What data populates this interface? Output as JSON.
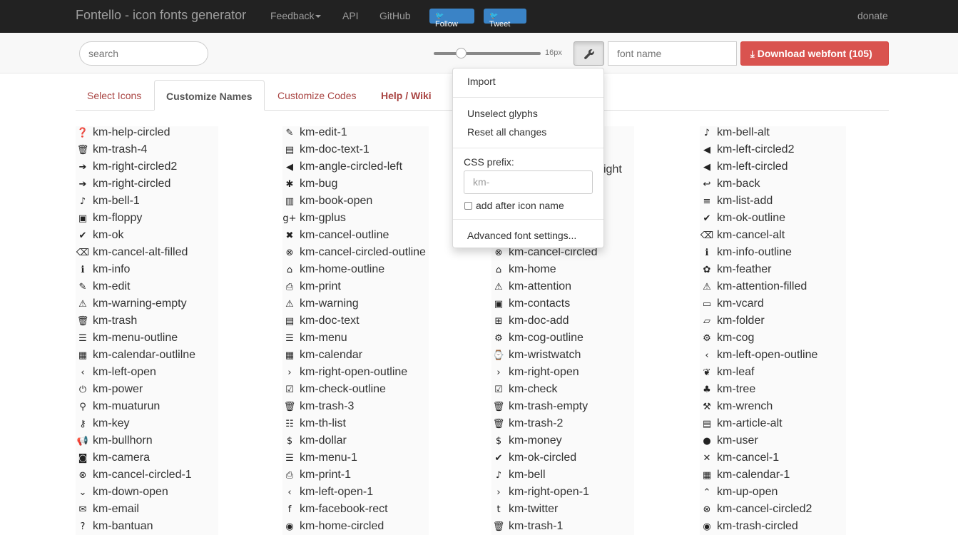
{
  "navbar": {
    "brand": "Fontello - icon fonts generator",
    "feedback": "Feedback",
    "api": "API",
    "github": "GitHub",
    "follow": "Follow",
    "tweet": "Tweet",
    "donate": "donate"
  },
  "toolbar": {
    "search_placeholder": "search",
    "size_label": "16px",
    "font_name_placeholder": "font name",
    "download_label": "Download webfont (105)"
  },
  "tabs": {
    "select": "Select Icons",
    "customize_names": "Customize Names",
    "customize_codes": "Customize Codes",
    "help": "Help / Wiki"
  },
  "dropdown": {
    "import": "Import",
    "unselect": "Unselect glyphs",
    "reset": "Reset all changes",
    "css_prefix_label": "CSS prefix:",
    "css_prefix_value": "km-",
    "add_after_label": "add after icon name",
    "advanced": "Advanced font settings..."
  },
  "columns": [
    [
      {
        "icon": "help-circled-icon",
        "glyph": "❓",
        "name": "km-help-circled"
      },
      {
        "icon": "trash-icon",
        "glyph": "🗑",
        "name": "km-trash-4"
      },
      {
        "icon": "right-circled-icon",
        "glyph": "➔",
        "name": "km-right-circled2"
      },
      {
        "icon": "right-circled-icon",
        "glyph": "➔",
        "name": "km-right-circled"
      },
      {
        "icon": "bell-icon",
        "glyph": "♪",
        "name": "km-bell-1"
      },
      {
        "icon": "floppy-icon",
        "glyph": "▣",
        "name": "km-floppy"
      },
      {
        "icon": "ok-icon",
        "glyph": "✔",
        "name": "km-ok"
      },
      {
        "icon": "cancel-alt-filled-icon",
        "glyph": "⌫",
        "name": "km-cancel-alt-filled"
      },
      {
        "icon": "info-icon",
        "glyph": "ℹ",
        "name": "km-info"
      },
      {
        "icon": "edit-icon",
        "glyph": "✎",
        "name": "km-edit"
      },
      {
        "icon": "warning-empty-icon",
        "glyph": "⚠",
        "name": "km-warning-empty"
      },
      {
        "icon": "trash-icon",
        "glyph": "🗑",
        "name": "km-trash"
      },
      {
        "icon": "menu-outline-icon",
        "glyph": "☰",
        "name": "km-menu-outline"
      },
      {
        "icon": "calendar-icon",
        "glyph": "▦",
        "name": "km-calendar-outlilne"
      },
      {
        "icon": "left-open-icon",
        "glyph": "‹",
        "name": "km-left-open"
      },
      {
        "icon": "power-icon",
        "glyph": "⏻",
        "name": "km-power"
      },
      {
        "icon": "muaturun-icon",
        "glyph": "⚲",
        "name": "km-muaturun"
      },
      {
        "icon": "key-icon",
        "glyph": "⚷",
        "name": "km-key"
      },
      {
        "icon": "bullhorn-icon",
        "glyph": "📢",
        "name": "km-bullhorn"
      },
      {
        "icon": "camera-icon",
        "glyph": "◙",
        "name": "km-camera"
      },
      {
        "icon": "cancel-circled-icon",
        "glyph": "⊗",
        "name": "km-cancel-circled-1"
      },
      {
        "icon": "down-open-icon",
        "glyph": "⌄",
        "name": "km-down-open"
      },
      {
        "icon": "email-icon",
        "glyph": "✉",
        "name": "km-email"
      },
      {
        "icon": "bantuan-icon",
        "glyph": "?",
        "name": "km-bantuan"
      }
    ],
    [
      {
        "icon": "edit-icon",
        "glyph": "✎",
        "name": "km-edit-1"
      },
      {
        "icon": "doc-text-icon",
        "glyph": "▤",
        "name": "km-doc-text-1"
      },
      {
        "icon": "angle-circled-left-icon",
        "glyph": "◀",
        "name": "km-angle-circled-left"
      },
      {
        "icon": "bug-icon",
        "glyph": "✱",
        "name": "km-bug"
      },
      {
        "icon": "book-open-icon",
        "glyph": "▥",
        "name": "km-book-open"
      },
      {
        "icon": "gplus-icon",
        "glyph": "g+",
        "name": "km-gplus"
      },
      {
        "icon": "cancel-outline-icon",
        "glyph": "✖",
        "name": "km-cancel-outline"
      },
      {
        "icon": "cancel-circled-outline-icon",
        "glyph": "⊗",
        "name": "km-cancel-circled-outline"
      },
      {
        "icon": "home-outline-icon",
        "glyph": "⌂",
        "name": "km-home-outline"
      },
      {
        "icon": "print-icon",
        "glyph": "⎙",
        "name": "km-print"
      },
      {
        "icon": "warning-icon",
        "glyph": "⚠",
        "name": "km-warning"
      },
      {
        "icon": "doc-text-icon",
        "glyph": "▤",
        "name": "km-doc-text"
      },
      {
        "icon": "menu-icon",
        "glyph": "☰",
        "name": "km-menu"
      },
      {
        "icon": "calendar-icon",
        "glyph": "▦",
        "name": "km-calendar"
      },
      {
        "icon": "right-open-outline-icon",
        "glyph": "›",
        "name": "km-right-open-outline"
      },
      {
        "icon": "check-outline-icon",
        "glyph": "☑",
        "name": "km-check-outline"
      },
      {
        "icon": "trash-icon",
        "glyph": "🗑",
        "name": "km-trash-3"
      },
      {
        "icon": "th-list-icon",
        "glyph": "☷",
        "name": "km-th-list"
      },
      {
        "icon": "dollar-icon",
        "glyph": "$",
        "name": "km-dollar"
      },
      {
        "icon": "menu-icon",
        "glyph": "☰",
        "name": "km-menu-1"
      },
      {
        "icon": "print-icon",
        "glyph": "⎙",
        "name": "km-print-1"
      },
      {
        "icon": "left-open-icon",
        "glyph": "‹",
        "name": "km-left-open-1"
      },
      {
        "icon": "facebook-rect-icon",
        "glyph": "f",
        "name": "km-facebook-rect"
      },
      {
        "icon": "home-circled-icon",
        "glyph": "◉",
        "name": "km-home-circled"
      }
    ],
    [
      {
        "icon": "cancel-circled-icon",
        "glyph": "⊗",
        "name": "km-cancel-circled"
      },
      {
        "icon": "home-icon",
        "glyph": "⌂",
        "name": "km-home"
      },
      {
        "icon": "attention-icon",
        "glyph": "⚠",
        "name": "km-attention"
      },
      {
        "icon": "contacts-icon",
        "glyph": "▣",
        "name": "km-contacts"
      },
      {
        "icon": "doc-add-icon",
        "glyph": "⊞",
        "name": "km-doc-add"
      },
      {
        "icon": "cog-outline-icon",
        "glyph": "⚙",
        "name": "km-cog-outline"
      },
      {
        "icon": "wristwatch-icon",
        "glyph": "⌚",
        "name": "km-wristwatch"
      },
      {
        "icon": "right-open-icon",
        "glyph": "›",
        "name": "km-right-open"
      },
      {
        "icon": "check-icon",
        "glyph": "☑",
        "name": "km-check"
      },
      {
        "icon": "trash-empty-icon",
        "glyph": "🗑",
        "name": "km-trash-empty"
      },
      {
        "icon": "trash-icon",
        "glyph": "🗑",
        "name": "km-trash-2"
      },
      {
        "icon": "money-icon",
        "glyph": "$",
        "name": "km-money"
      },
      {
        "icon": "ok-circled-icon",
        "glyph": "✔",
        "name": "km-ok-circled"
      },
      {
        "icon": "bell-icon",
        "glyph": "♪",
        "name": "km-bell"
      },
      {
        "icon": "right-open-icon",
        "glyph": "›",
        "name": "km-right-open-1"
      },
      {
        "icon": "twitter-icon",
        "glyph": "t",
        "name": "km-twitter"
      },
      {
        "icon": "trash-icon",
        "glyph": "🗑",
        "name": "km-trash-1"
      }
    ],
    [
      {
        "icon": "bell-alt-icon",
        "glyph": "♪",
        "name": "km-bell-alt"
      },
      {
        "icon": "left-circled-icon",
        "glyph": "◀",
        "name": "km-left-circled2"
      },
      {
        "icon": "left-circled-icon",
        "glyph": "◀",
        "name": "km-left-circled"
      },
      {
        "icon": "back-icon",
        "glyph": "↩",
        "name": "km-back"
      },
      {
        "icon": "list-add-icon",
        "glyph": "≡",
        "name": "km-list-add"
      },
      {
        "icon": "ok-outline-icon",
        "glyph": "✔",
        "name": "km-ok-outline"
      },
      {
        "icon": "cancel-alt-icon",
        "glyph": "⌫",
        "name": "km-cancel-alt"
      },
      {
        "icon": "info-outline-icon",
        "glyph": "ℹ",
        "name": "km-info-outline"
      },
      {
        "icon": "feather-icon",
        "glyph": "✿",
        "name": "km-feather"
      },
      {
        "icon": "attention-filled-icon",
        "glyph": "⚠",
        "name": "km-attention-filled"
      },
      {
        "icon": "vcard-icon",
        "glyph": "▭",
        "name": "km-vcard"
      },
      {
        "icon": "folder-icon",
        "glyph": "▱",
        "name": "km-folder"
      },
      {
        "icon": "cog-icon",
        "glyph": "⚙",
        "name": "km-cog"
      },
      {
        "icon": "left-open-outline-icon",
        "glyph": "‹",
        "name": "km-left-open-outline"
      },
      {
        "icon": "leaf-icon",
        "glyph": "❦",
        "name": "km-leaf"
      },
      {
        "icon": "tree-icon",
        "glyph": "♣",
        "name": "km-tree"
      },
      {
        "icon": "wrench-icon",
        "glyph": "⚒",
        "name": "km-wrench"
      },
      {
        "icon": "article-alt-icon",
        "glyph": "▤",
        "name": "km-article-alt"
      },
      {
        "icon": "user-icon",
        "glyph": "●",
        "name": "km-user"
      },
      {
        "icon": "cancel-icon",
        "glyph": "✕",
        "name": "km-cancel-1"
      },
      {
        "icon": "calendar-icon",
        "glyph": "▦",
        "name": "km-calendar-1"
      },
      {
        "icon": "up-open-icon",
        "glyph": "⌃",
        "name": "km-up-open"
      },
      {
        "icon": "cancel-circled2-icon",
        "glyph": "⊗",
        "name": "km-cancel-circled2"
      },
      {
        "icon": "trash-circled-icon",
        "glyph": "◉",
        "name": "km-trash-circled"
      }
    ]
  ],
  "partial_text": {
    "col3_right_fragment": "ight"
  }
}
